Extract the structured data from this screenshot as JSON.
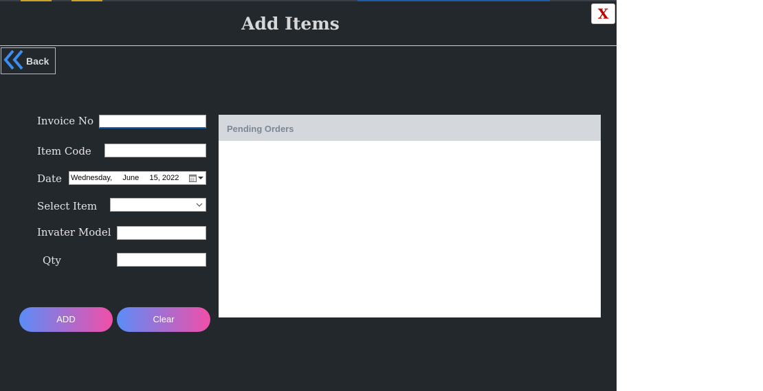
{
  "window": {
    "title": "Add Items",
    "close_label": "X",
    "back_label": "Back"
  },
  "form": {
    "invoice_no": {
      "label": "Invoice No",
      "value": ""
    },
    "item_code": {
      "label": "Item Code",
      "value": ""
    },
    "date": {
      "label": "Date",
      "value": "Wednesday,     June     15, 2022"
    },
    "select_item": {
      "label": "Select Item",
      "value": ""
    },
    "invater_model": {
      "label": "Invater Model",
      "value": ""
    },
    "qty": {
      "label": "Qty",
      "value": ""
    }
  },
  "buttons": {
    "add_label": "ADD",
    "clear_label": "Clear"
  },
  "pending_orders": {
    "title": "Pending Orders",
    "rows": []
  },
  "colors": {
    "background": "#23282d",
    "close_red": "#c00000",
    "gradient_start": "#5b8cf7",
    "gradient_end": "#f04fa8",
    "back_chevron": "#3b8ff0"
  }
}
